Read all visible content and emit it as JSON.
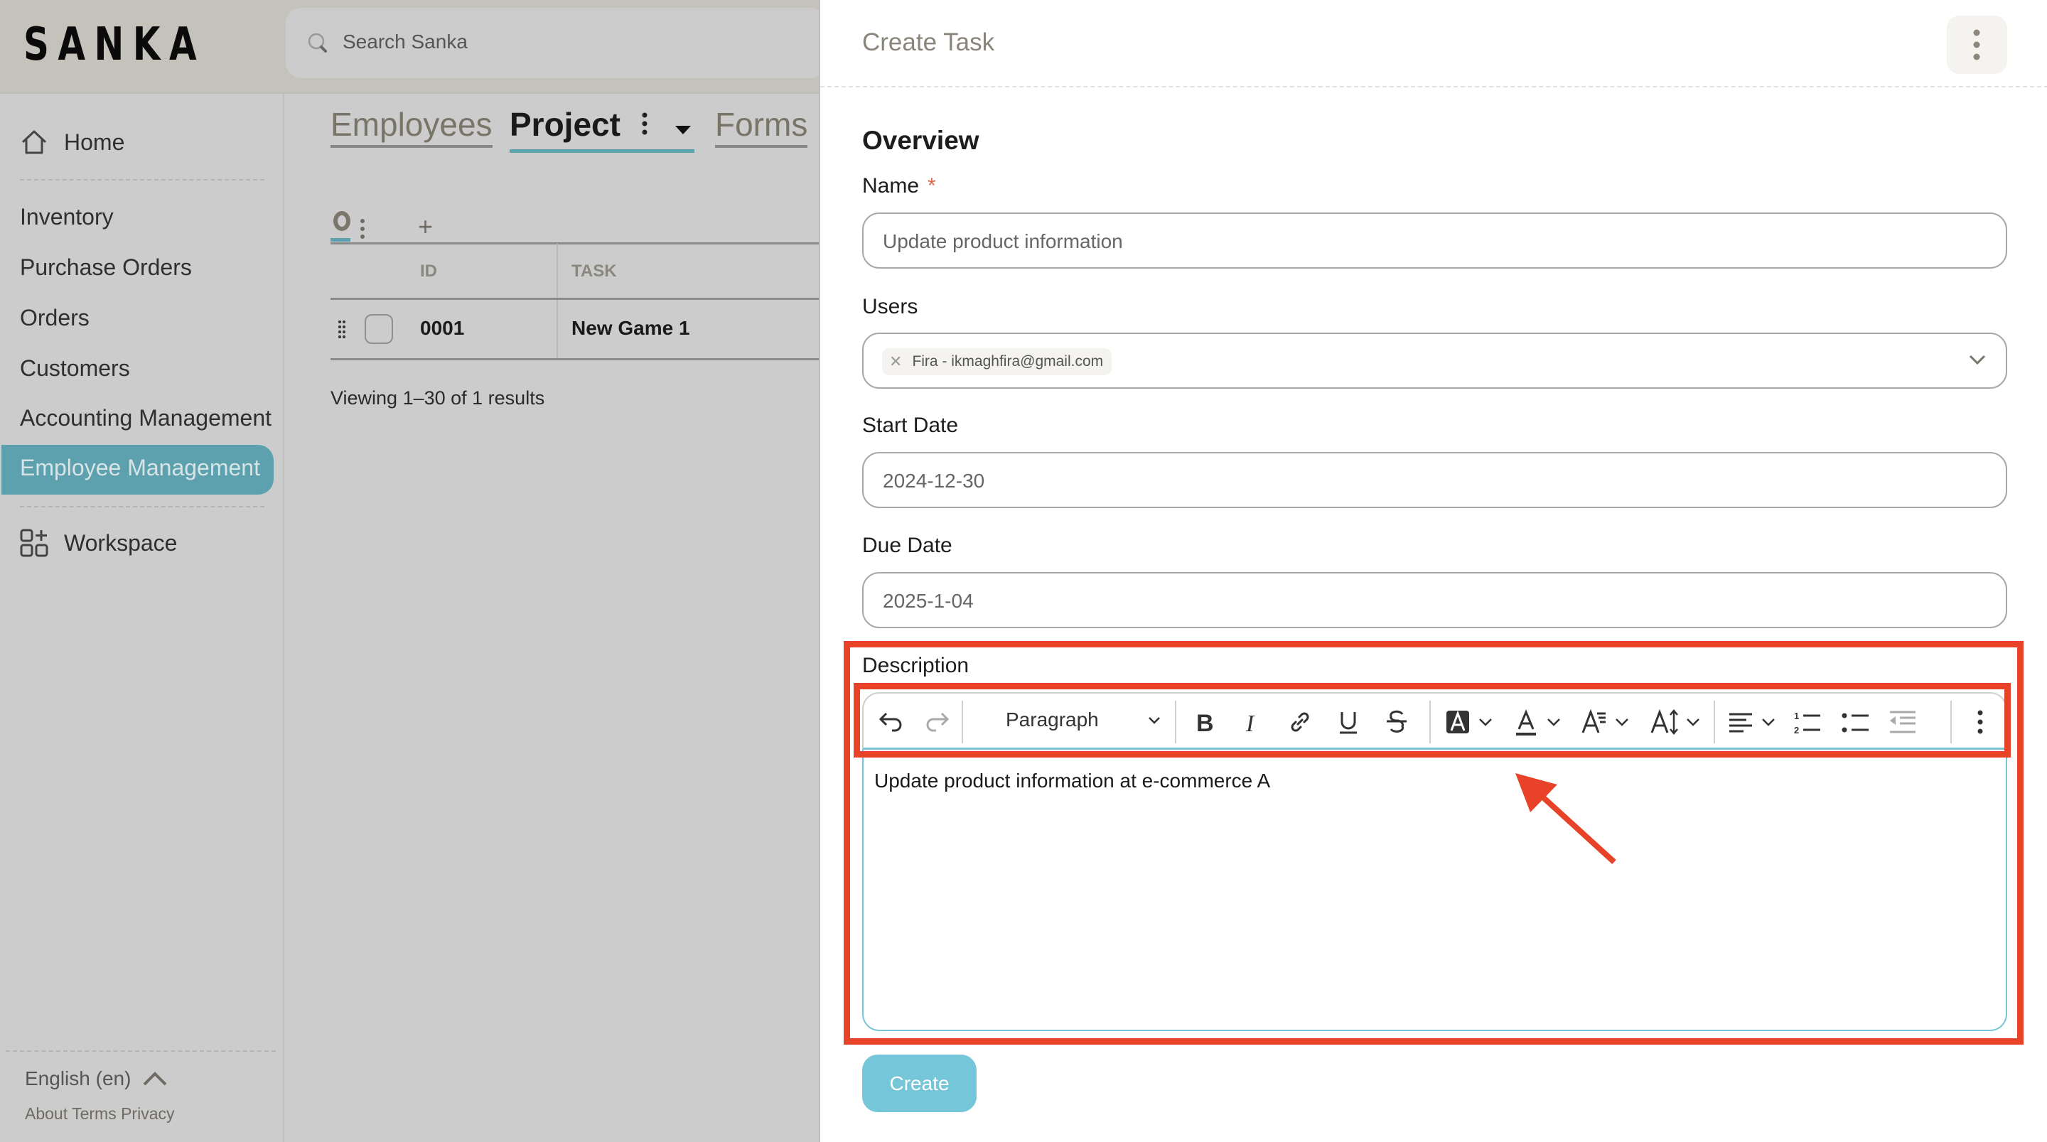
{
  "app": {
    "logo": "SANKA",
    "search_placeholder": "Search Sanka"
  },
  "sidebar": {
    "home": "Home",
    "items": [
      {
        "label": "Inventory"
      },
      {
        "label": "Purchase Orders"
      },
      {
        "label": "Orders"
      },
      {
        "label": "Customers"
      },
      {
        "label": "Accounting Management"
      },
      {
        "label": "Employee Management",
        "active": true
      }
    ],
    "workspace": "Workspace",
    "language": "English (en)",
    "footer_links": "About Terms Privacy"
  },
  "main": {
    "tabs": [
      {
        "label": "Employees"
      },
      {
        "label": "Project",
        "active": true
      },
      {
        "label": "Forms"
      }
    ],
    "view_add": "+",
    "table": {
      "headers": [
        "ID",
        "TASK"
      ],
      "rows": [
        {
          "id": "0001",
          "task": "New Game 1"
        }
      ]
    },
    "viewing": "Viewing 1–30 of 1 results"
  },
  "drawer": {
    "title": "Create Task",
    "section": "Overview",
    "fields": {
      "name": {
        "label": "Name",
        "required_mark": "*",
        "value": "Update product information"
      },
      "users": {
        "label": "Users",
        "chips": [
          "Fira - ikmaghfira@gmail.com"
        ]
      },
      "start_date": {
        "label": "Start Date",
        "value": "2024-12-30"
      },
      "due_date": {
        "label": "Due Date",
        "value": "2025-1-04"
      },
      "description": {
        "label": "Description",
        "block_type": "Paragraph",
        "content": "Update product information at e-commerce A"
      }
    },
    "toolbar_buttons": [
      "undo",
      "redo",
      "block-type",
      "bold",
      "italic",
      "link",
      "underline",
      "strikethrough",
      "highlight-color",
      "text-color",
      "font-family",
      "font-size",
      "align",
      "ordered-list",
      "bullet-list",
      "outdent",
      "more"
    ],
    "create_label": "Create"
  },
  "colors": {
    "accent": "#5da0ae",
    "button": "#74c6d8",
    "annotation": "#e84228",
    "required": "#e0694e"
  }
}
